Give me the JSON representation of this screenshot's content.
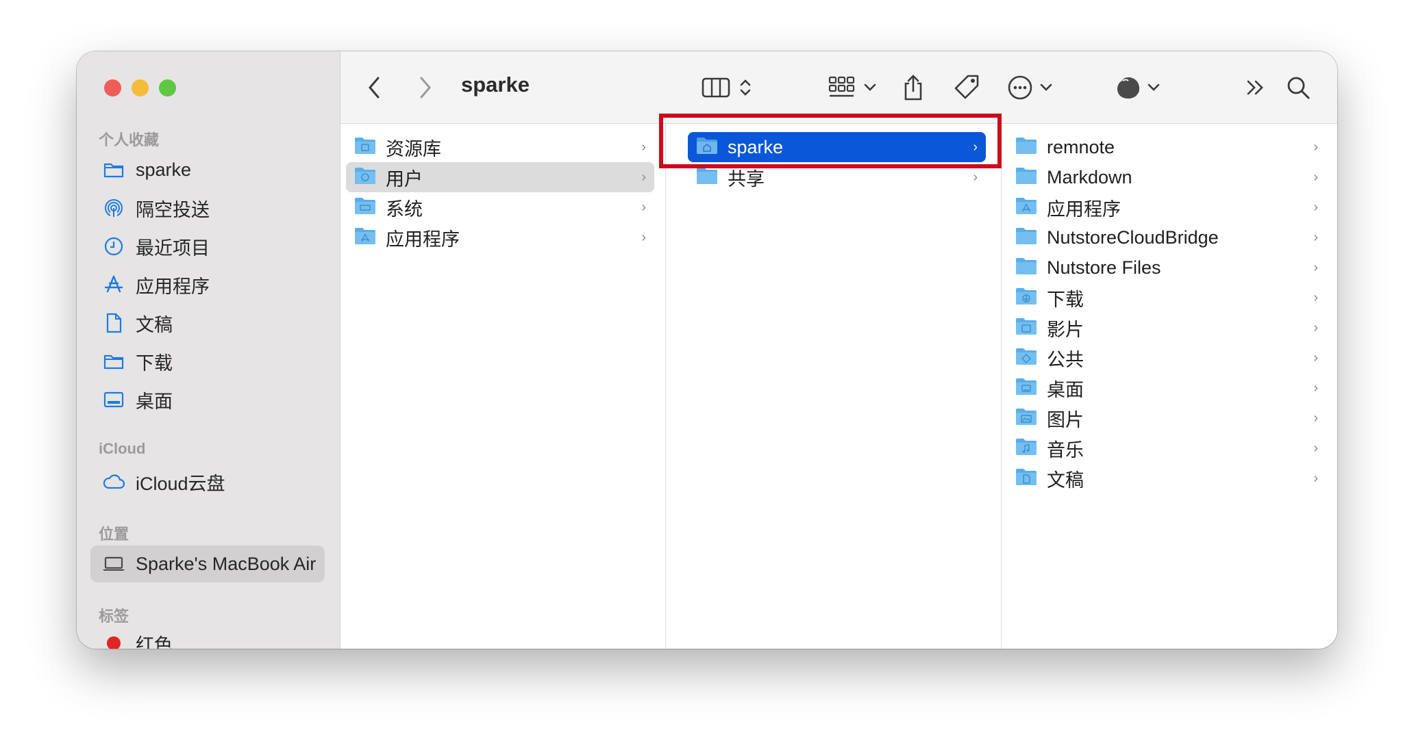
{
  "window": {
    "title": "sparke"
  },
  "sidebar": {
    "favorites_header": "个人收藏",
    "favorites": [
      {
        "label": "sparke",
        "icon": "folder-icon"
      },
      {
        "label": "隔空投送",
        "icon": "airdrop-icon"
      },
      {
        "label": "最近项目",
        "icon": "clock-icon"
      },
      {
        "label": "应用程序",
        "icon": "apps-icon"
      },
      {
        "label": "文稿",
        "icon": "document-icon"
      },
      {
        "label": "下载",
        "icon": "folder-icon"
      },
      {
        "label": "桌面",
        "icon": "desktop-icon"
      }
    ],
    "icloud_header": "iCloud",
    "icloud": [
      {
        "label": "iCloud云盘",
        "icon": "cloud-icon"
      }
    ],
    "locations_header": "位置",
    "locations": [
      {
        "label": "Sparke's MacBook Air",
        "icon": "laptop-icon",
        "selected": true
      }
    ],
    "tags_header": "标签",
    "tags": [
      {
        "label": "红色",
        "color": "#e32424"
      }
    ]
  },
  "columns": [
    {
      "items": [
        {
          "label": "资源库",
          "state": "normal"
        },
        {
          "label": "用户",
          "state": "selected-inactive"
        },
        {
          "label": "系统",
          "state": "normal"
        },
        {
          "label": "应用程序",
          "state": "normal"
        }
      ]
    },
    {
      "items": [
        {
          "label": "sparke",
          "state": "selected-active"
        },
        {
          "label": "共享",
          "state": "normal"
        }
      ]
    },
    {
      "items": [
        {
          "label": "remnote"
        },
        {
          "label": "Markdown"
        },
        {
          "label": "应用程序"
        },
        {
          "label": "NutstoreCloudBridge"
        },
        {
          "label": "Nutstore Files"
        },
        {
          "label": "下载"
        },
        {
          "label": "影片"
        },
        {
          "label": "公共"
        },
        {
          "label": "桌面"
        },
        {
          "label": "图片"
        },
        {
          "label": "音乐"
        },
        {
          "label": "文稿"
        }
      ]
    }
  ],
  "colors": {
    "accent": "#0a57d8",
    "highlight_box": "#cc0a1c",
    "folder": "#5aaee8"
  }
}
